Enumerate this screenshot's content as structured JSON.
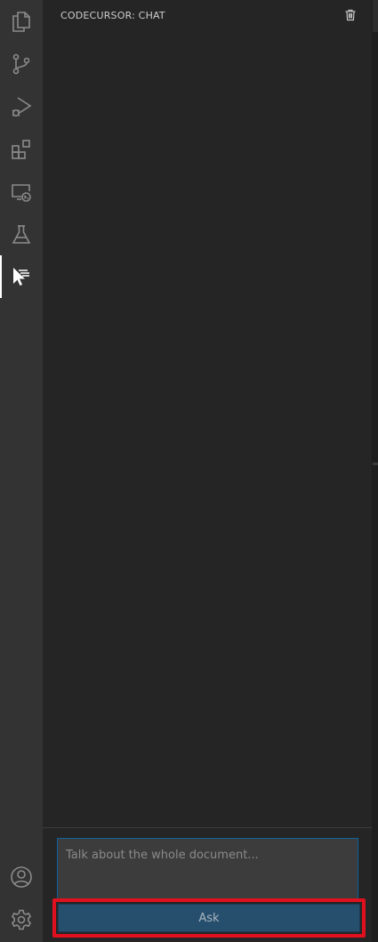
{
  "activity_bar": {
    "items": [
      {
        "name": "explorer",
        "icon": "files-icon"
      },
      {
        "name": "source-control",
        "icon": "source-control-icon"
      },
      {
        "name": "run-and-debug",
        "icon": "run-debug-icon"
      },
      {
        "name": "extensions",
        "icon": "extensions-icon"
      },
      {
        "name": "remote-explorer",
        "icon": "remote-explorer-icon"
      },
      {
        "name": "testing",
        "icon": "beaker-icon"
      },
      {
        "name": "codecursor",
        "icon": "codecursor-icon",
        "active": true
      }
    ],
    "bottom_items": [
      {
        "name": "accounts",
        "icon": "account-icon"
      },
      {
        "name": "manage",
        "icon": "gear-icon"
      }
    ]
  },
  "panel": {
    "title": "CODECURSOR: CHAT",
    "clear_icon": "trash-icon"
  },
  "chat": {
    "input_placeholder": "Talk about the whole document...",
    "input_value": "",
    "ask_label": "Ask"
  },
  "colors": {
    "activity_bar_bg": "#333333",
    "panel_bg": "#252526",
    "input_border": "#0e639c",
    "ask_button_bg": "#264f6e",
    "highlight_border": "#e0101e"
  }
}
